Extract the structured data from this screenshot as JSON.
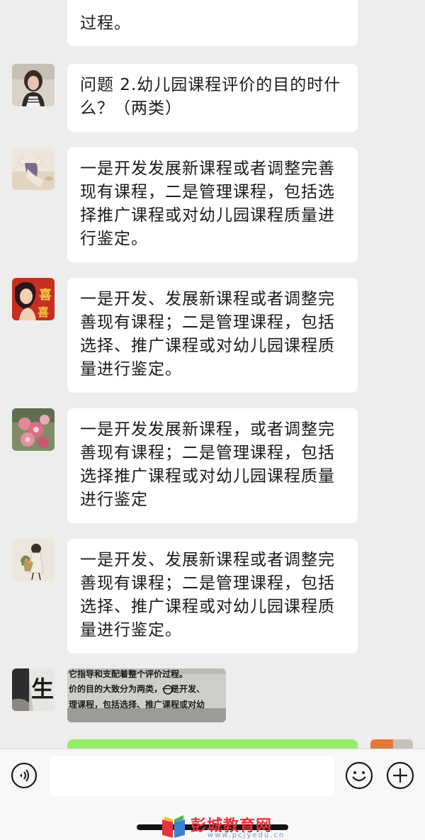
{
  "chat": {
    "messages": [
      {
        "sender": "contact",
        "type": "text",
        "text": "过程。"
      },
      {
        "sender": "contact",
        "type": "text",
        "text": "问题 2.幼儿园课程评价的目的时什么？（两类）"
      },
      {
        "sender": "contact",
        "type": "text",
        "text": "一是开发发展新课程或者调整完善现有课程，二是管理课程，包括选择推广课程或对幼儿园课程质量进行鉴定。"
      },
      {
        "sender": "contact",
        "type": "text",
        "text": "一是开发、发展新课程或者调整完善现有课程；二是管理课程，包括选择、推广课程或对幼儿园课程质量进行鉴定。"
      },
      {
        "sender": "contact",
        "type": "text",
        "text": "一是开发发展新课程，或者调整完善现有课程；二是管理课程，包括选择推广课程或对幼儿园课程质量进行鉴定"
      },
      {
        "sender": "contact",
        "type": "text",
        "text": "一是开发、发展新课程或者调整完善现有课程；二是管理课程，包括选择、推广课程或对幼儿园课程质量进行鉴定。"
      },
      {
        "sender": "contact",
        "type": "image",
        "image_lines": [
          "它指导和支配着整个评价过程。",
          "价的目的大致分为两类，一是开发、",
          "理课程，包括选择、推广课程或对幼"
        ]
      },
      {
        "sender": "self",
        "type": "text",
        "text": ""
      }
    ]
  },
  "input_bar": {
    "placeholder": "",
    "voice_icon": "voice-icon",
    "emoji_icon": "emoji-icon",
    "plus_icon": "plus-icon"
  },
  "watermark": {
    "text": "彭城教育网",
    "url": "www.pcjyedu.cn"
  },
  "colors": {
    "background": "#ededed",
    "bubble_incoming": "#ffffff",
    "bubble_outgoing": "#95ec69",
    "input_bar": "#f7f7f7",
    "watermark_red": "#e8333a"
  }
}
